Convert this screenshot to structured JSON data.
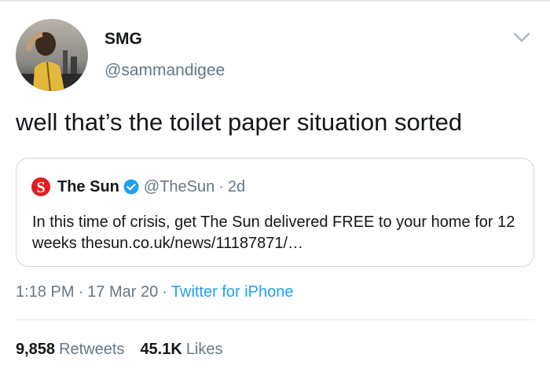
{
  "author": {
    "name": "SMG",
    "handle": "@sammandigee"
  },
  "tweet": {
    "text": "well that’s the toilet paper situation sorted"
  },
  "quoted": {
    "name": "The Sun",
    "handle": "@TheSun",
    "separator": "·",
    "time": "2d",
    "text": "In this time of crisis, get The Sun delivered FREE to your home for 12 weeks thesun.co.uk/news/11187871/…"
  },
  "meta": {
    "time": "1:18 PM",
    "separator": "·",
    "date": "17 Mar 20",
    "source": "Twitter for iPhone"
  },
  "stats": {
    "retweets_count": "9,858",
    "retweets_label": "Retweets",
    "likes_count": "45.1K",
    "likes_label": "Likes"
  },
  "colors": {
    "text": "#14171a",
    "secondary": "#657786",
    "link": "#1da1f2",
    "border": "#ccd6dd",
    "sun_red": "#e01e24"
  },
  "icons": {
    "chevron": "chevron-down-icon",
    "verified": "verified-badge-icon",
    "logo": "the-sun-logo-icon"
  }
}
